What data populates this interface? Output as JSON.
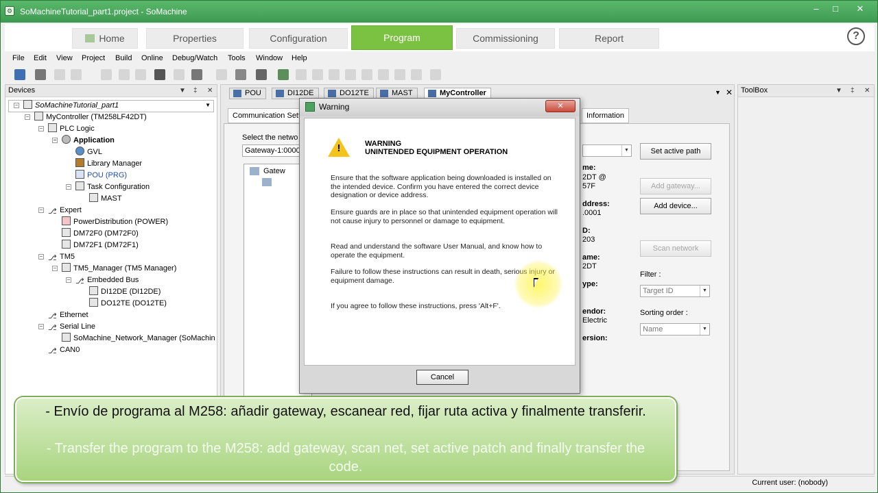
{
  "window": {
    "title": "SoMachineTutorial_part1.project - SoMachine",
    "controls": {
      "minimize": "–",
      "maximize": "□",
      "close": "✕"
    }
  },
  "ribbon": {
    "tabs": [
      {
        "label": "Home"
      },
      {
        "label": "Properties"
      },
      {
        "label": "Configuration"
      },
      {
        "label": "Program"
      },
      {
        "label": "Commissioning"
      },
      {
        "label": "Report"
      }
    ],
    "active_tab": "Program",
    "help": "?"
  },
  "menubar": [
    "File",
    "Edit",
    "View",
    "Project",
    "Build",
    "Online",
    "Debug/Watch",
    "Tools",
    "Window",
    "Help"
  ],
  "devices_panel": {
    "title": "Devices",
    "controls": {
      "dropdown": "▼",
      "pin": "‡",
      "close": "✕"
    },
    "tree": [
      {
        "label": "SoMachineTutorial_part1",
        "italic": true
      },
      {
        "label": "MyController (TM258LF42DT)"
      },
      {
        "label": "PLC Logic"
      },
      {
        "label": "Application",
        "bold": true
      },
      {
        "label": "GVL"
      },
      {
        "label": "Library Manager"
      },
      {
        "label": "POU (PRG)",
        "blue": true
      },
      {
        "label": "Task Configuration"
      },
      {
        "label": "MAST"
      },
      {
        "label": "Expert"
      },
      {
        "label": "PowerDistribution (POWER)"
      },
      {
        "label": "DM72F0 (DM72F0)"
      },
      {
        "label": "DM72F1 (DM72F1)"
      },
      {
        "label": "TM5"
      },
      {
        "label": "TM5_Manager (TM5 Manager)"
      },
      {
        "label": "Embedded Bus"
      },
      {
        "label": "DI12DE (DI12DE)"
      },
      {
        "label": "DO12TE (DO12TE)"
      },
      {
        "label": "Ethernet"
      },
      {
        "label": "Serial Line"
      },
      {
        "label": "SoMachine_Network_Manager (SoMachin"
      },
      {
        "label": "CAN0"
      }
    ]
  },
  "editor": {
    "tabs": [
      {
        "label": "POU"
      },
      {
        "label": "DI12DE"
      },
      {
        "label": "DO12TE"
      },
      {
        "label": "MAST"
      },
      {
        "label": "MyController"
      }
    ],
    "subtabs": {
      "communication": "Communication Setti",
      "information": "Information"
    },
    "select_network_label": "Select the netwo",
    "gateway_combo": "Gateway-1:0000",
    "tree_node": "Gatew",
    "buttons": {
      "set_active_path": "Set active path",
      "add_gateway": "Add gateway...",
      "add_device": "Add device...",
      "scan_network": "Scan network"
    },
    "info_lines": {
      "name_label": "me:",
      "name_value_1": "2DT @",
      "name_value_2": "57F",
      "address_label": "ddress:",
      "address_value": ".0001",
      "id_label": "D:",
      "id_value": "203",
      "devname_label": "ame:",
      "devname_value": "2DT",
      "type_label": "ype:",
      "vendor_label": "endor:",
      "vendor_value": "Electric",
      "version_label": "ersion:"
    },
    "filter_label": "Filter :",
    "filter_value": "Target ID",
    "sorting_label": "Sorting order :",
    "sorting_value": "Name"
  },
  "toolbox": {
    "title": "ToolBox",
    "controls": {
      "dropdown": "▼",
      "pin": "‡",
      "close": "✕"
    }
  },
  "statusbar": {
    "user": "Current user: (nobody)"
  },
  "dialog": {
    "title": "Warning",
    "close": "✕",
    "heading_1": "WARNING",
    "heading_2": "UNINTENDED EQUIPMENT OPERATION",
    "paragraphs": [
      "Ensure that the software application being downloaded is installed on the intended device.  Confirm you have entered the correct device designation or device address.",
      "Ensure guards are in place so that unintended equipment operation will not cause injury to personnel or damage to equipment.",
      "Read and understand the software User Manual, and know how to operate the equipment.",
      "Failure to follow these instructions can result in death, serious injury or equipment damage.",
      "If you agree to follow these instructions, press 'Alt+F'."
    ],
    "cancel": "Cancel"
  },
  "subtitle": {
    "spanish": "- Envío de programa al M258: añadir gateway, escanear red, fijar ruta activa y finalmente transferir.",
    "english": "- Transfer the program to the M258: add gateway, scan net, set active patch and finally transfer the code."
  },
  "colors": {
    "ribbon_active": "#7cc242",
    "titlebar": "#4aa85e",
    "warning_yellow": "#f3c51a"
  }
}
